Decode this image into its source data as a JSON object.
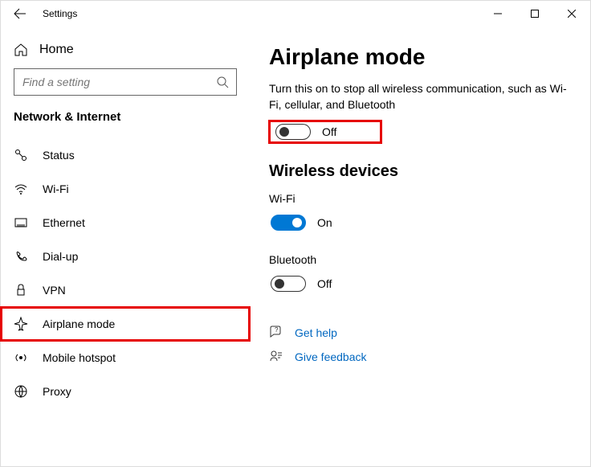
{
  "titlebar": {
    "title": "Settings"
  },
  "sidebar": {
    "home_label": "Home",
    "search_placeholder": "Find a setting",
    "section_title": "Network & Internet",
    "items": [
      {
        "label": "Status"
      },
      {
        "label": "Wi-Fi"
      },
      {
        "label": "Ethernet"
      },
      {
        "label": "Dial-up"
      },
      {
        "label": "VPN"
      },
      {
        "label": "Airplane mode"
      },
      {
        "label": "Mobile hotspot"
      },
      {
        "label": "Proxy"
      }
    ]
  },
  "main": {
    "title": "Airplane mode",
    "description": "Turn this on to stop all wireless communication, such as Wi-Fi, cellular, and Bluetooth",
    "airplane_toggle_state": "Off",
    "wireless_heading": "Wireless devices",
    "wifi_label": "Wi-Fi",
    "wifi_state": "On",
    "bt_label": "Bluetooth",
    "bt_state": "Off",
    "help_link": "Get help",
    "feedback_link": "Give feedback"
  }
}
